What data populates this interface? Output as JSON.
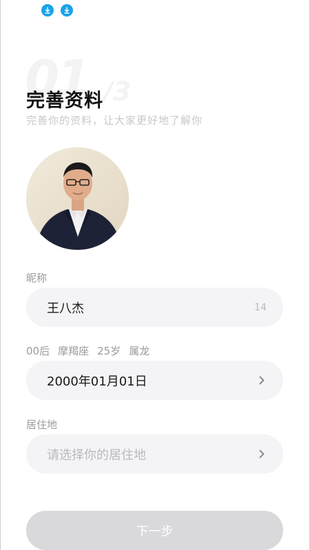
{
  "status_bar": {
    "icons": [
      "download-icon",
      "download-icon"
    ]
  },
  "step": {
    "current": "01",
    "total": "/3"
  },
  "header": {
    "title": "完善资料",
    "subtitle": "完善你的资料，让大家更好地了解你"
  },
  "avatar": {
    "alt": "用户头像"
  },
  "nickname": {
    "label": "昵称",
    "value": "王八杰",
    "remaining": "14"
  },
  "birthday": {
    "tags": [
      "00后",
      "摩羯座",
      "25岁",
      "属龙"
    ],
    "value": "2000年01月01日"
  },
  "residence": {
    "label": "居住地",
    "placeholder": "请选择你的居住地"
  },
  "footer": {
    "next_label": "下一步"
  },
  "colors": {
    "accent_icon": "#1aa3e8",
    "field_bg": "#f4f4f6",
    "button_disabled": "#d9d9dc"
  }
}
